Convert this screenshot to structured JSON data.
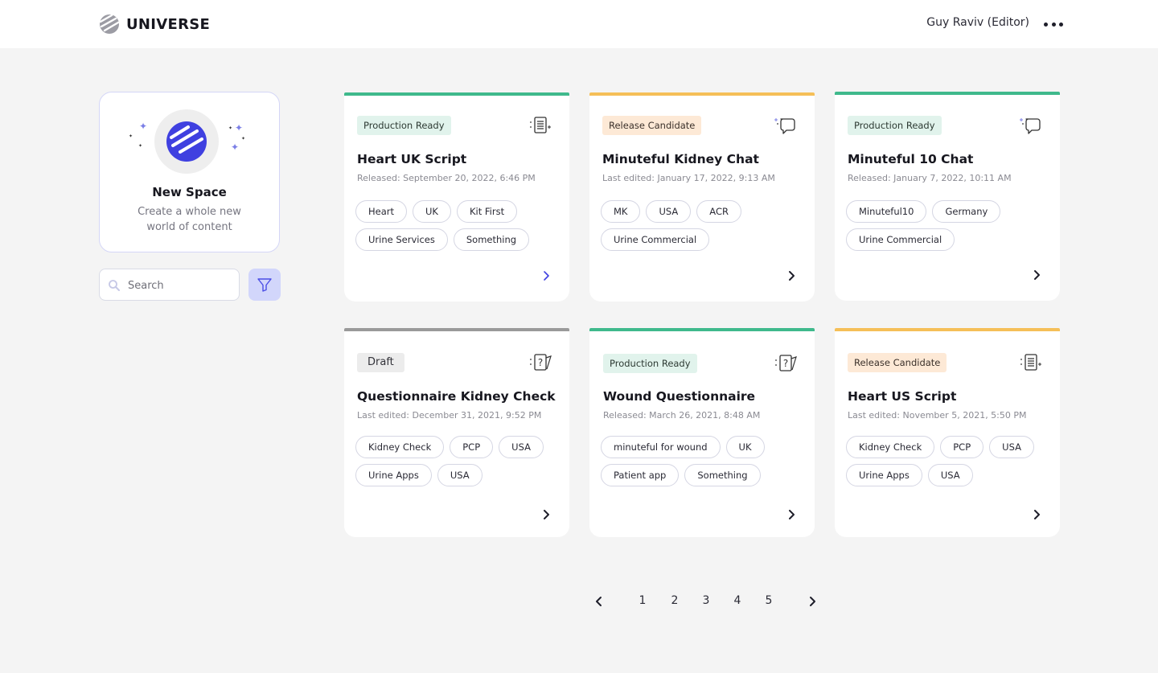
{
  "header": {
    "brand": "UNIVERSE",
    "user": "Guy Raviv (Editor)"
  },
  "new_space": {
    "title": "New Space",
    "description": "Create a whole new world of content"
  },
  "search": {
    "placeholder": "Search",
    "value": ""
  },
  "colors": {
    "production_ready": "#3fb98c",
    "release_candidate": "#f5bf58",
    "draft": "#9a9a9a",
    "accent": "#3f40e0"
  },
  "cards": [
    {
      "status": "Production Ready",
      "type_icon": "script-icon",
      "title": "Heart UK Script",
      "date": "Released: September 20, 2022, 6:46 PM",
      "tags": [
        "Heart",
        "UK",
        "Kit First",
        "Urine Services",
        "Something"
      ]
    },
    {
      "status": "Release Candidate",
      "type_icon": "chat-icon",
      "title": "Minuteful Kidney Chat",
      "date": "Last edited: January 17, 2022, 9:13 AM",
      "tags": [
        "MK",
        "USA",
        "ACR",
        "Urine Commercial"
      ]
    },
    {
      "status": "Production Ready",
      "type_icon": "chat-icon",
      "title": "Minuteful 10 Chat",
      "date": "Released: January 7, 2022, 10:11 AM",
      "tags": [
        "Minuteful10",
        "Germany",
        "Urine Commercial"
      ]
    },
    {
      "status": "Draft",
      "type_icon": "questionnaire-icon",
      "title": "Questionnaire Kidney Check",
      "date": "Last edited: December 31, 2021, 9:52 PM",
      "tags": [
        "Kidney Check",
        "PCP",
        "USA",
        "Urine Apps",
        "USA"
      ]
    },
    {
      "status": "Production Ready",
      "type_icon": "questionnaire-icon",
      "title": "Wound Questionnaire",
      "date": "Released: March 26, 2021, 8:48 AM",
      "tags": [
        "minuteful for wound",
        "UK",
        "Patient app",
        "Something"
      ]
    },
    {
      "status": "Release Candidate",
      "type_icon": "script-icon",
      "title": "Heart US Script",
      "date": "Last edited: November 5, 2021, 5:50 PM",
      "tags": [
        "Kidney Check",
        "PCP",
        "USA",
        "Urine Apps",
        "USA"
      ]
    }
  ],
  "pagination": {
    "pages": [
      "1",
      "2",
      "3",
      "4",
      "5"
    ]
  }
}
